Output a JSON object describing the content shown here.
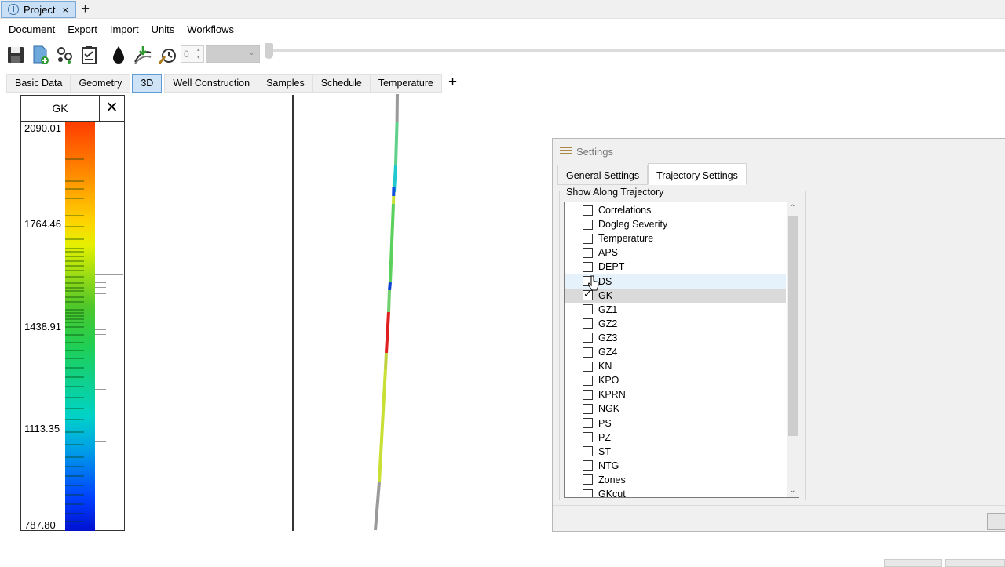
{
  "tabs": {
    "document_tab": "Project",
    "close_glyph": "×",
    "add_glyph": "+"
  },
  "menu": [
    "Document",
    "Export",
    "Import",
    "Units",
    "Workflows"
  ],
  "toolbar": {
    "icons": [
      "save-icon",
      "new-document-icon",
      "wells-icon",
      "checklist-icon",
      "droplet-icon",
      "import-curves-icon",
      "clock-tool-icon"
    ],
    "spin_value": "0",
    "combo_value": ""
  },
  "view_tabs": {
    "items": [
      "Basic Data",
      "Geometry",
      "3D",
      "Well Construction",
      "Samples",
      "Schedule",
      "Temperature"
    ],
    "active": "3D",
    "add_glyph": "+"
  },
  "log_panel": {
    "title": "GK",
    "close_glyph": "✕",
    "depth_labels": [
      "2090.01",
      "1764.46",
      "1438.91",
      "1113.35",
      "787.80"
    ]
  },
  "settings": {
    "title": "Settings",
    "tabs": [
      "General Settings",
      "Trajectory Settings"
    ],
    "active_tab": "Trajectory Settings",
    "group_label": "Show Along Trajectory",
    "items": [
      {
        "label": "Correlations",
        "checked": false
      },
      {
        "label": "Dogleg Severity",
        "checked": false
      },
      {
        "label": "Temperature",
        "checked": false
      },
      {
        "label": "APS",
        "checked": false
      },
      {
        "label": "DEPT",
        "checked": false
      },
      {
        "label": "DS",
        "checked": false,
        "state": "hover"
      },
      {
        "label": "GK",
        "checked": true,
        "state": "selected"
      },
      {
        "label": "GZ1",
        "checked": false
      },
      {
        "label": "GZ2",
        "checked": false
      },
      {
        "label": "GZ3",
        "checked": false
      },
      {
        "label": "GZ4",
        "checked": false
      },
      {
        "label": "KN",
        "checked": false
      },
      {
        "label": "KPO",
        "checked": false
      },
      {
        "label": "KPRN",
        "checked": false
      },
      {
        "label": "NGK",
        "checked": false
      },
      {
        "label": "PS",
        "checked": false
      },
      {
        "label": "PZ",
        "checked": false
      },
      {
        "label": "ST",
        "checked": false
      },
      {
        "label": "NTG",
        "checked": false
      },
      {
        "label": "Zones",
        "checked": false
      },
      {
        "label": "GKcut",
        "checked": false
      }
    ],
    "scroll_up_glyph": "⌃",
    "scroll_down_glyph": "⌄"
  },
  "colors": {
    "accent": "#5e9bd6",
    "active_tab_bg": "#cfe3f7"
  }
}
